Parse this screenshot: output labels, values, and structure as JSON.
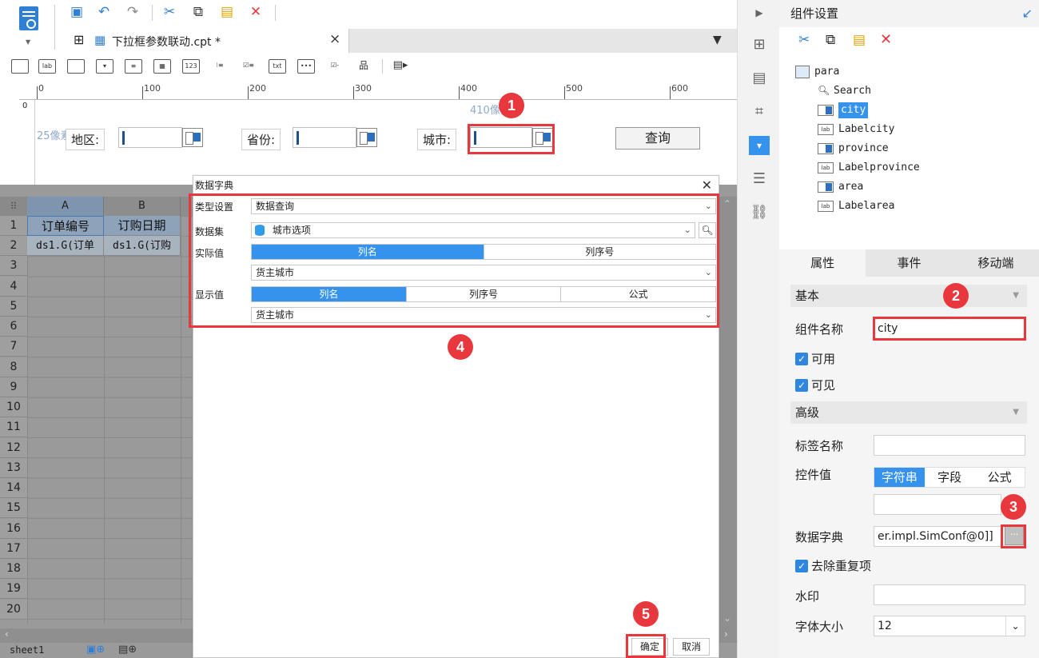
{
  "toolbar": {
    "icons": [
      "save-icon",
      "undo-icon",
      "redo-icon",
      "cut-icon",
      "copy-icon",
      "paste-icon",
      "delete-icon"
    ],
    "colors": {
      "blue": "#2f7fd4",
      "red": "#e8383d",
      "accent": "#3593ee"
    }
  },
  "tab": {
    "title": "下拉框参数联动.cpt *",
    "close": "×"
  },
  "ruler": {
    "labels": [
      "0",
      "100",
      "200",
      "300",
      "400",
      "500",
      "600"
    ]
  },
  "param_panel": {
    "width_hint": "410像素",
    "height_hint": "25像素",
    "area_label": "地区:",
    "province_label": "省份:",
    "city_label": "城市:",
    "query_button": "查询"
  },
  "grid": {
    "columns": [
      "A",
      "B"
    ],
    "header_row": [
      "订单编号",
      "订购日期"
    ],
    "row2": [
      "ds1.G(订单",
      "ds1.G(订购"
    ],
    "row_numbers": [
      "1",
      "2",
      "3",
      "4",
      "5",
      "6",
      "7",
      "8",
      "9",
      "10",
      "11",
      "12",
      "13",
      "14",
      "15",
      "16",
      "17",
      "18",
      "19",
      "20"
    ],
    "sheet_tab": "sheet1"
  },
  "dialog": {
    "title": "数据字典",
    "type_label": "类型设置",
    "type_value": "数据查询",
    "dataset_label": "数据集",
    "dataset_value": "城市选项",
    "actual_label": "实际值",
    "actual_seg": [
      "列名",
      "列序号"
    ],
    "actual_value": "货主城市",
    "display_label": "显示值",
    "display_seg": [
      "列名",
      "列序号",
      "公式"
    ],
    "display_value": "货主城市",
    "ok": "确定",
    "cancel": "取消"
  },
  "markers": [
    "1",
    "2",
    "3",
    "4",
    "5"
  ],
  "right_panel": {
    "title": "组件设置",
    "tree": {
      "root": "para",
      "items": [
        "Search",
        "city",
        "Labelcity",
        "province",
        "Labelprovince",
        "area",
        "Labelarea"
      ]
    },
    "tabs": [
      "属性",
      "事件",
      "移动端"
    ],
    "sections": {
      "basic": "基本",
      "advanced": "高级"
    },
    "props": {
      "name_label": "组件名称",
      "name_value": "city",
      "enabled": "可用",
      "visible": "可见",
      "tag_label": "标签名称",
      "tag_value": "",
      "ctrl_value_label": "控件值",
      "ctrl_value_seg": [
        "字符串",
        "字段",
        "公式"
      ],
      "dict_label": "数据字典",
      "dict_value": "er.impl.SimConf@0]]",
      "dict_button": "···",
      "dedupe": "去除重复项",
      "watermark_label": "水印",
      "fontsize_label": "字体大小",
      "fontsize_value": "12"
    }
  }
}
